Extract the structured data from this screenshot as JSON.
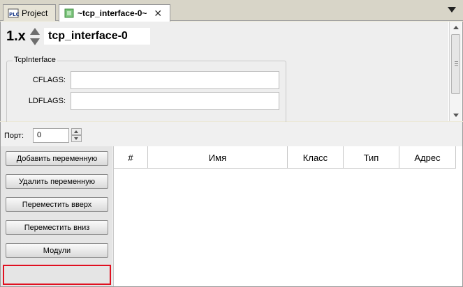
{
  "tabs": [
    {
      "label": "Project",
      "icon": "plc-icon"
    },
    {
      "label": "~tcp_interface-0~",
      "icon": "module-icon"
    }
  ],
  "header": {
    "version": "1.x",
    "name_value": "tcp_interface-0"
  },
  "group": {
    "title": "TcpInterface",
    "fields": [
      {
        "label": "CFLAGS:",
        "value": ""
      },
      {
        "label": "LDFLAGS:",
        "value": ""
      }
    ]
  },
  "port": {
    "label": "Порт:",
    "value": "0"
  },
  "buttons": {
    "add": "Добавить переменную",
    "remove": "Удалить переменную",
    "move_up": "Переместить вверх",
    "move_down": "Переместить вниз",
    "modules": "Модули"
  },
  "table": {
    "columns": [
      "#",
      "Имя",
      "Класс",
      "Тип",
      "Адрес"
    ],
    "rows": []
  },
  "colors": {
    "highlight": "#e01020"
  }
}
